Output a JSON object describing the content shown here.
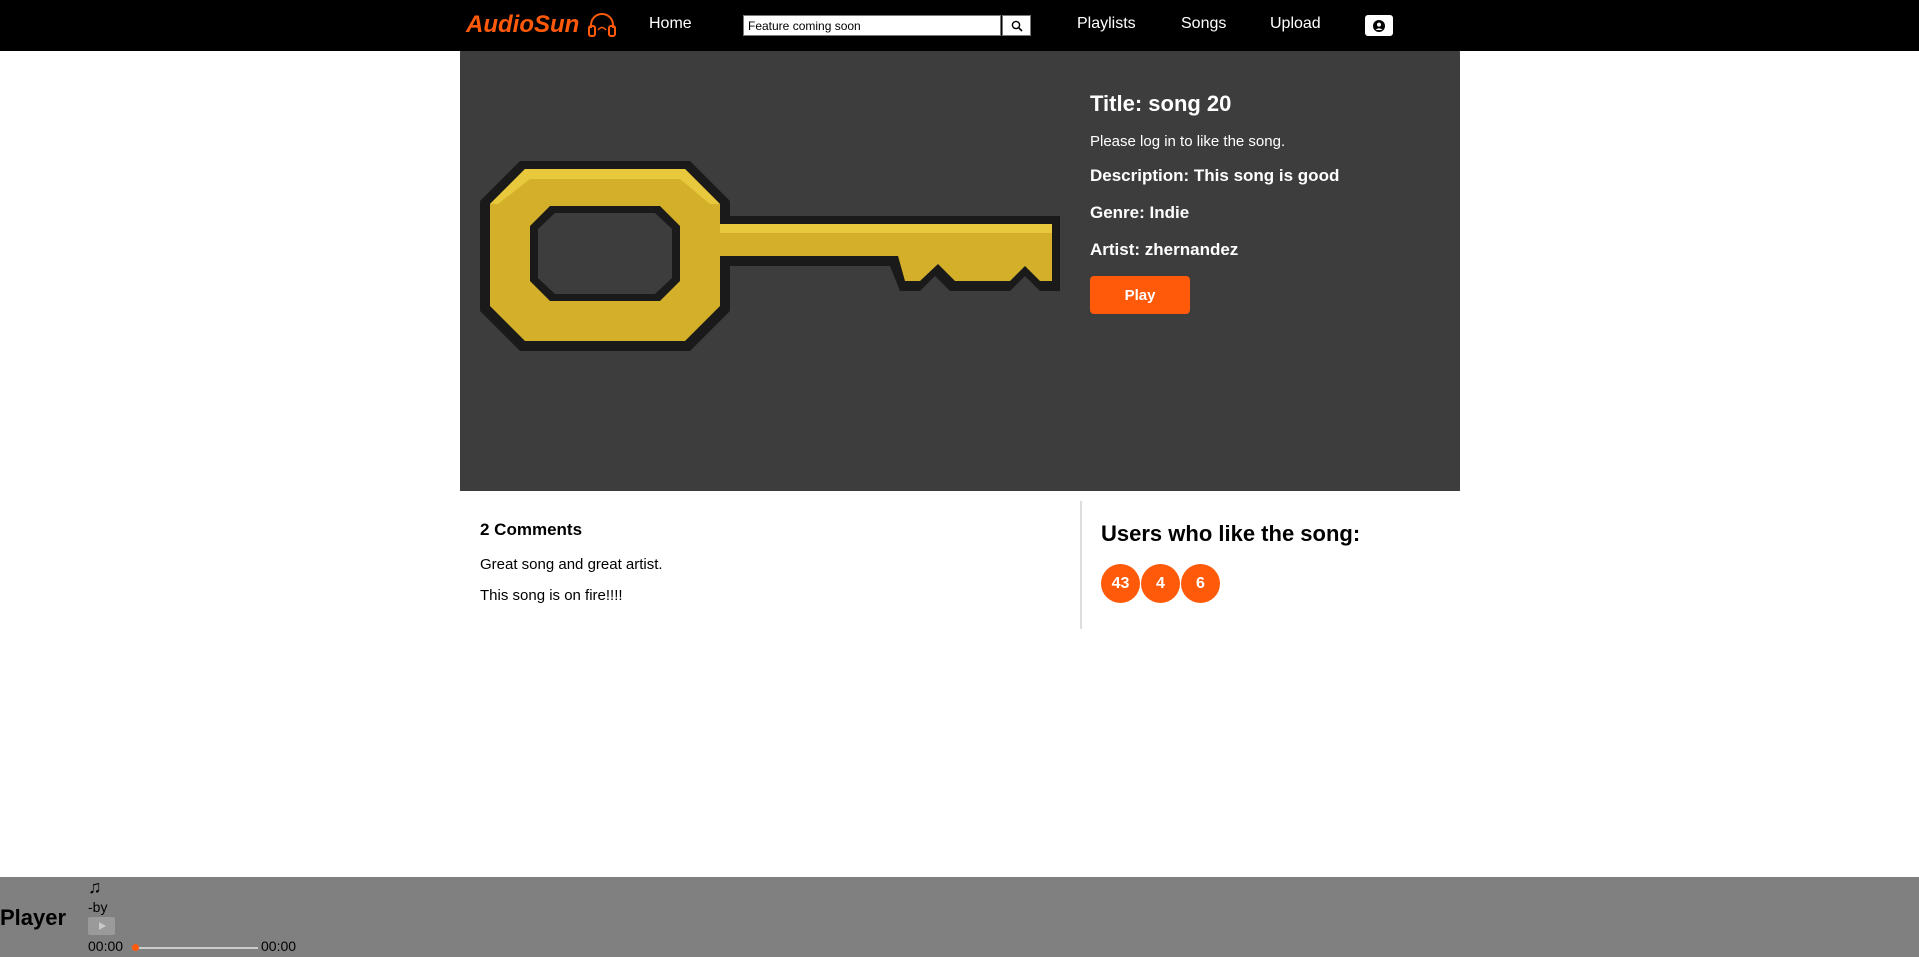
{
  "nav": {
    "brand": "AudioSun",
    "home": "Home",
    "search_value": "Feature coming soon",
    "playlists": "Playlists",
    "songs": "Songs",
    "upload": "Upload"
  },
  "song": {
    "title": "Title: song 20",
    "login_note": "Please log in to like the song.",
    "description": "Description: This song is good",
    "genre": "Genre: Indie",
    "artist": "Artist: zhernandez",
    "play_label": "Play"
  },
  "comments": {
    "heading": "2 Comments",
    "items": [
      "Great song and great artist.",
      "This song is on fire!!!!"
    ]
  },
  "likes": {
    "heading": "Users who like the song:",
    "users": [
      "43",
      "4",
      "6"
    ]
  },
  "player": {
    "label": "Player",
    "note": "♫",
    "by_line": "-by",
    "current_time": "00:00",
    "duration": "00:00",
    "progress": 0
  },
  "colors": {
    "accent": "#ff5a0a",
    "hero_bg": "#3d3d3d",
    "player_bg": "#808080"
  }
}
